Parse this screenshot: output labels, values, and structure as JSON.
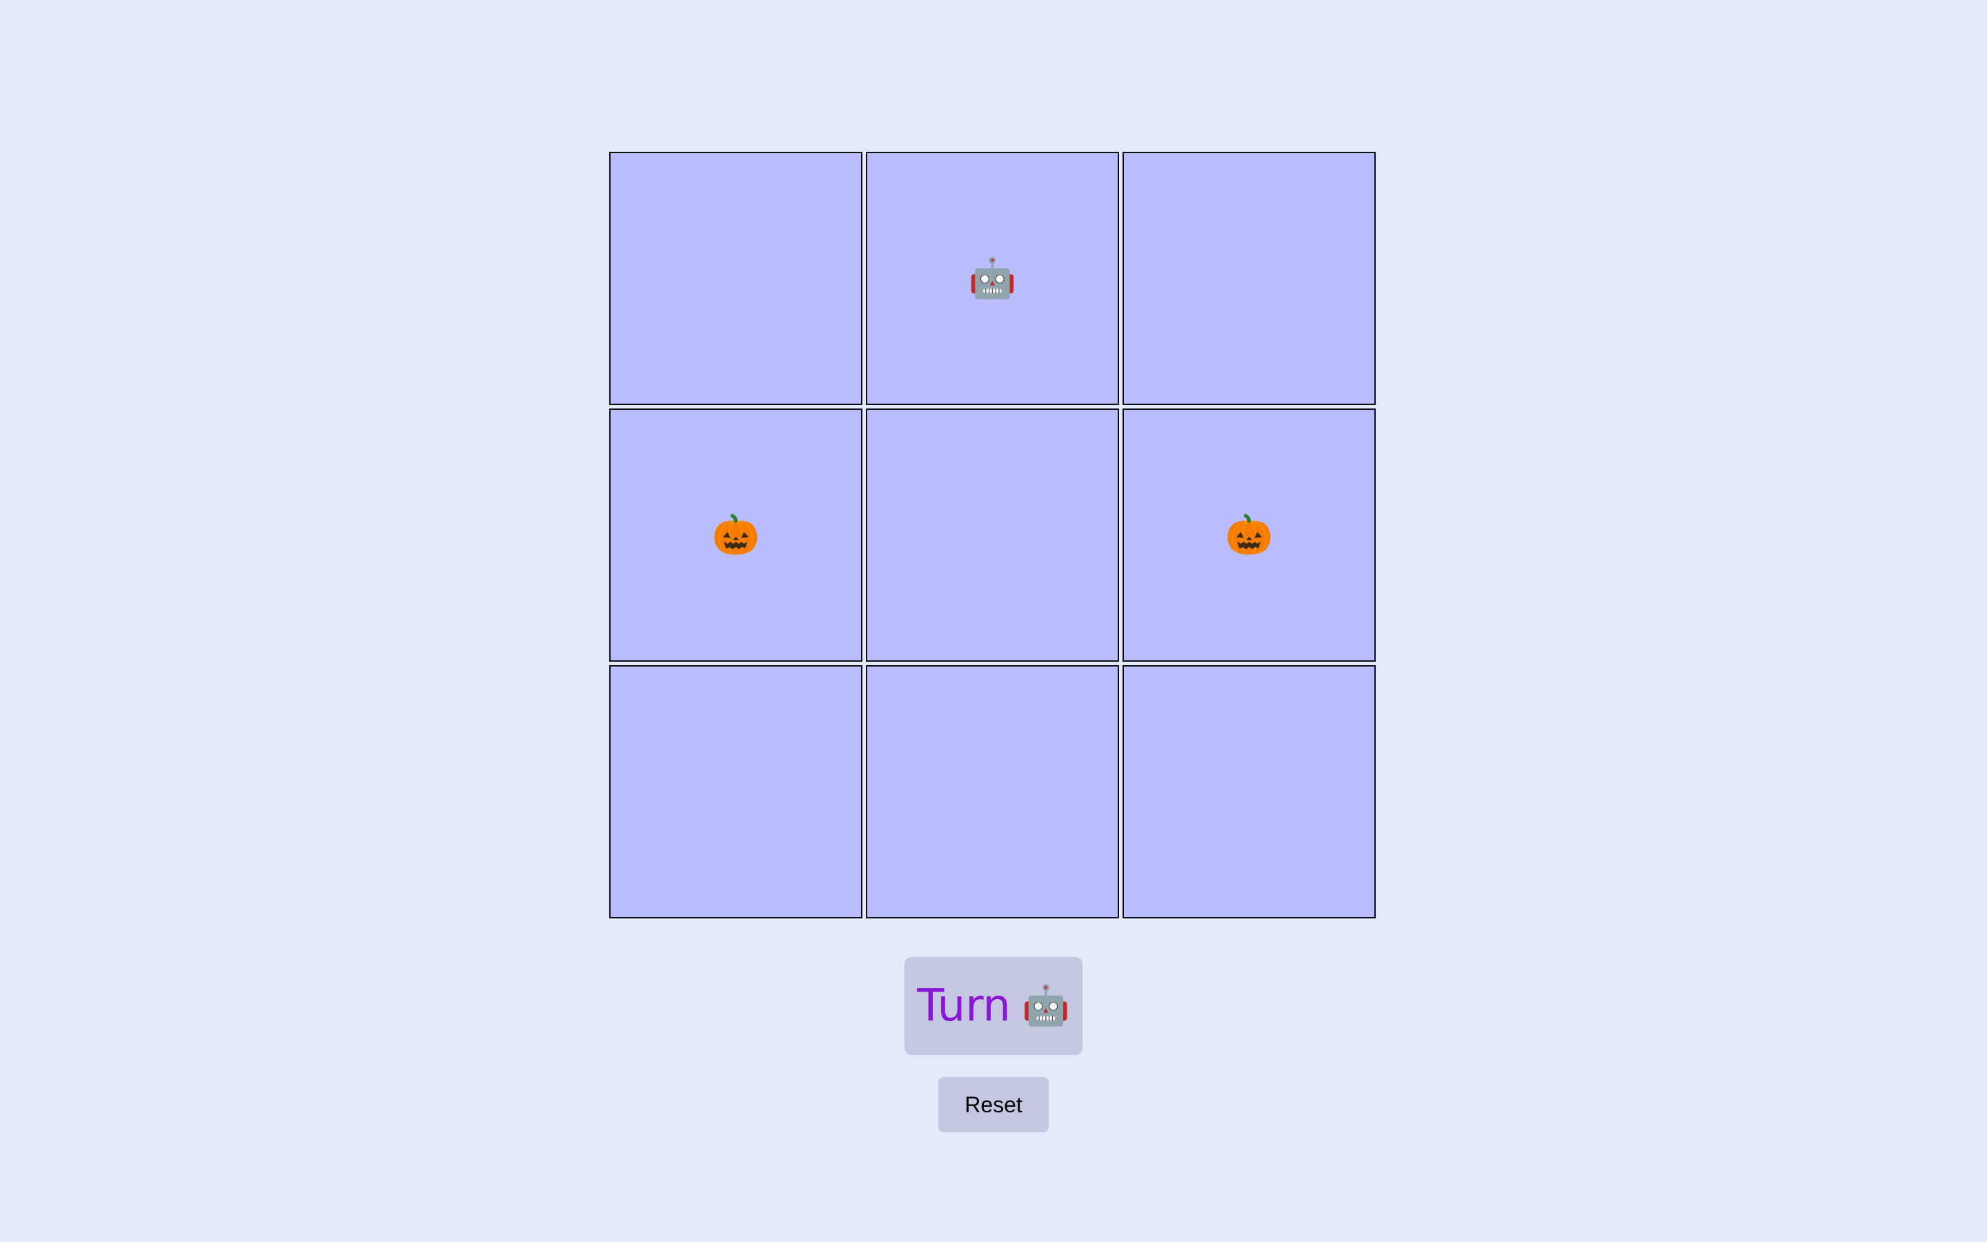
{
  "theme": {
    "background": "#e4eafb",
    "cell_fill": "#b9bdfd",
    "cell_border": "#0d0d12",
    "panel_fill": "#c5c6e2",
    "turn_text_color": "#8a17d6"
  },
  "board": {
    "cells": [
      {
        "mark": ""
      },
      {
        "mark": "🤖"
      },
      {
        "mark": ""
      },
      {
        "mark": "🎃"
      },
      {
        "mark": ""
      },
      {
        "mark": "🎃"
      },
      {
        "mark": ""
      },
      {
        "mark": ""
      },
      {
        "mark": ""
      }
    ]
  },
  "turn": {
    "label": "Turn",
    "player_icon": "🤖"
  },
  "controls": {
    "reset_label": "Reset"
  }
}
